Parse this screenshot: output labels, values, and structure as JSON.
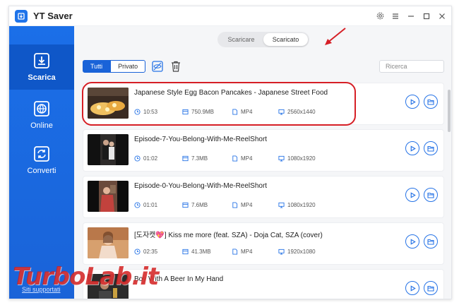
{
  "app": {
    "title": "YT Saver"
  },
  "titlebar": {
    "icons": [
      "settings-icon",
      "menu-icon",
      "minimize-icon",
      "maximize-icon",
      "close-icon"
    ]
  },
  "sidebar": {
    "items": [
      {
        "label": "Scarica",
        "icon": "download-icon",
        "active": true
      },
      {
        "label": "Online",
        "icon": "globe-icon",
        "active": false
      },
      {
        "label": "Converti",
        "icon": "convert-icon",
        "active": false
      }
    ],
    "support_label": "Siti supportati"
  },
  "tabs": [
    {
      "label": "Scaricare",
      "active": false
    },
    {
      "label": "Scaricato",
      "active": true
    }
  ],
  "filters": [
    {
      "label": "Tutti",
      "active": true
    },
    {
      "label": "Privato",
      "active": false
    }
  ],
  "search": {
    "placeholder": "Ricerca"
  },
  "videos": [
    {
      "title": "Japanese Style Egg Bacon Pancakes - Japanese Street Food",
      "duration": "10:53",
      "size": "750.9MB",
      "format": "MP4",
      "resolution": "2560x1440"
    },
    {
      "title": "Episode-7-You-Belong-With-Me-ReelShort",
      "duration": "01:02",
      "size": "7.3MB",
      "format": "MP4",
      "resolution": "1080x1920"
    },
    {
      "title": "Episode-0-You-Belong-With-Me-ReelShort",
      "duration": "01:01",
      "size": "7.6MB",
      "format": "MP4",
      "resolution": "1080x1920"
    },
    {
      "title": "[도자캣💖] Kiss me more (feat. SZA) - Doja Cat, SZA (cover)",
      "duration": "02:35",
      "size": "41.3MB",
      "format": "MP4",
      "resolution": "1920x1080"
    },
    {
      "title": "Boy With A Beer In My Hand",
      "duration": "",
      "size": "",
      "format": "",
      "resolution": ""
    }
  ],
  "watermark": "TurboLab.it",
  "colors": {
    "accent": "#1a63d8",
    "highlight": "#d61f26"
  }
}
